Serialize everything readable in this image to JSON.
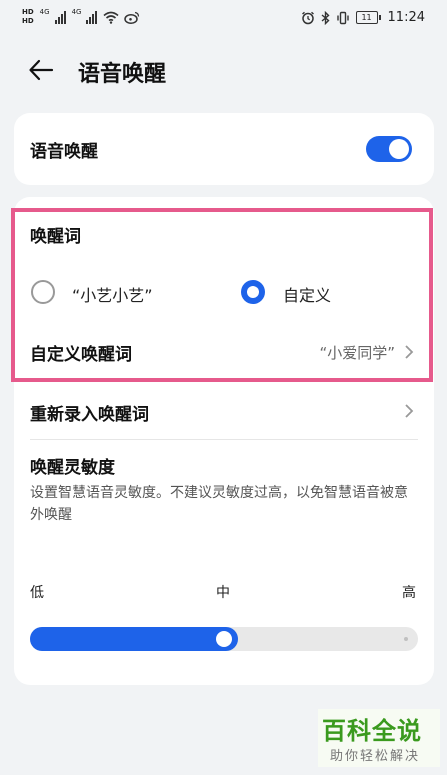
{
  "status_bar": {
    "hd_top": "HD",
    "hd_bottom": "HD",
    "net_1": "4G",
    "net_2": "4G",
    "battery": "11",
    "time": "11:24"
  },
  "header": {
    "title": "语音唤醒"
  },
  "voice_wake": {
    "label": "语音唤醒",
    "enabled": true
  },
  "wake_word": {
    "section_title": "唤醒词",
    "options": [
      {
        "label": "“小艺小艺”",
        "selected": false
      },
      {
        "label": "自定义",
        "selected": true
      }
    ],
    "custom_label": "自定义唤醒词",
    "custom_value": "“小爱同学”"
  },
  "rerecord": {
    "label": "重新录入唤醒词"
  },
  "sensitivity": {
    "title": "唤醒灵敏度",
    "description": "设置智慧语音灵敏度。不建议灵敏度过高，以免智慧语音被意外唤醒",
    "ticks": [
      "低",
      "中",
      "高"
    ],
    "level_fraction": 0.5
  },
  "watermark": {
    "title": "百科全说",
    "subtitle": "助你轻松解决"
  },
  "colors": {
    "accent": "#1e63e9",
    "highlight": "#e65a8c",
    "watermark_green": "#3a9a1e"
  }
}
